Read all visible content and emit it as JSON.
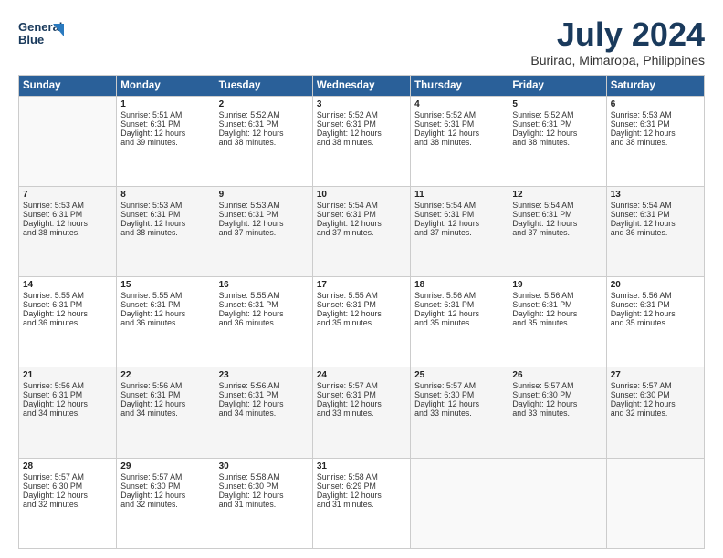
{
  "header": {
    "logo_line1": "General",
    "logo_line2": "Blue",
    "month": "July 2024",
    "location": "Burirao, Mimaropa, Philippines"
  },
  "weekdays": [
    "Sunday",
    "Monday",
    "Tuesday",
    "Wednesday",
    "Thursday",
    "Friday",
    "Saturday"
  ],
  "weeks": [
    [
      {
        "day": "",
        "info": ""
      },
      {
        "day": "1",
        "info": "Sunrise: 5:51 AM\nSunset: 6:31 PM\nDaylight: 12 hours\nand 39 minutes."
      },
      {
        "day": "2",
        "info": "Sunrise: 5:52 AM\nSunset: 6:31 PM\nDaylight: 12 hours\nand 38 minutes."
      },
      {
        "day": "3",
        "info": "Sunrise: 5:52 AM\nSunset: 6:31 PM\nDaylight: 12 hours\nand 38 minutes."
      },
      {
        "day": "4",
        "info": "Sunrise: 5:52 AM\nSunset: 6:31 PM\nDaylight: 12 hours\nand 38 minutes."
      },
      {
        "day": "5",
        "info": "Sunrise: 5:52 AM\nSunset: 6:31 PM\nDaylight: 12 hours\nand 38 minutes."
      },
      {
        "day": "6",
        "info": "Sunrise: 5:53 AM\nSunset: 6:31 PM\nDaylight: 12 hours\nand 38 minutes."
      }
    ],
    [
      {
        "day": "7",
        "info": "Sunrise: 5:53 AM\nSunset: 6:31 PM\nDaylight: 12 hours\nand 38 minutes."
      },
      {
        "day": "8",
        "info": "Sunrise: 5:53 AM\nSunset: 6:31 PM\nDaylight: 12 hours\nand 38 minutes."
      },
      {
        "day": "9",
        "info": "Sunrise: 5:53 AM\nSunset: 6:31 PM\nDaylight: 12 hours\nand 37 minutes."
      },
      {
        "day": "10",
        "info": "Sunrise: 5:54 AM\nSunset: 6:31 PM\nDaylight: 12 hours\nand 37 minutes."
      },
      {
        "day": "11",
        "info": "Sunrise: 5:54 AM\nSunset: 6:31 PM\nDaylight: 12 hours\nand 37 minutes."
      },
      {
        "day": "12",
        "info": "Sunrise: 5:54 AM\nSunset: 6:31 PM\nDaylight: 12 hours\nand 37 minutes."
      },
      {
        "day": "13",
        "info": "Sunrise: 5:54 AM\nSunset: 6:31 PM\nDaylight: 12 hours\nand 36 minutes."
      }
    ],
    [
      {
        "day": "14",
        "info": "Sunrise: 5:55 AM\nSunset: 6:31 PM\nDaylight: 12 hours\nand 36 minutes."
      },
      {
        "day": "15",
        "info": "Sunrise: 5:55 AM\nSunset: 6:31 PM\nDaylight: 12 hours\nand 36 minutes."
      },
      {
        "day": "16",
        "info": "Sunrise: 5:55 AM\nSunset: 6:31 PM\nDaylight: 12 hours\nand 36 minutes."
      },
      {
        "day": "17",
        "info": "Sunrise: 5:55 AM\nSunset: 6:31 PM\nDaylight: 12 hours\nand 35 minutes."
      },
      {
        "day": "18",
        "info": "Sunrise: 5:56 AM\nSunset: 6:31 PM\nDaylight: 12 hours\nand 35 minutes."
      },
      {
        "day": "19",
        "info": "Sunrise: 5:56 AM\nSunset: 6:31 PM\nDaylight: 12 hours\nand 35 minutes."
      },
      {
        "day": "20",
        "info": "Sunrise: 5:56 AM\nSunset: 6:31 PM\nDaylight: 12 hours\nand 35 minutes."
      }
    ],
    [
      {
        "day": "21",
        "info": "Sunrise: 5:56 AM\nSunset: 6:31 PM\nDaylight: 12 hours\nand 34 minutes."
      },
      {
        "day": "22",
        "info": "Sunrise: 5:56 AM\nSunset: 6:31 PM\nDaylight: 12 hours\nand 34 minutes."
      },
      {
        "day": "23",
        "info": "Sunrise: 5:56 AM\nSunset: 6:31 PM\nDaylight: 12 hours\nand 34 minutes."
      },
      {
        "day": "24",
        "info": "Sunrise: 5:57 AM\nSunset: 6:31 PM\nDaylight: 12 hours\nand 33 minutes."
      },
      {
        "day": "25",
        "info": "Sunrise: 5:57 AM\nSunset: 6:30 PM\nDaylight: 12 hours\nand 33 minutes."
      },
      {
        "day": "26",
        "info": "Sunrise: 5:57 AM\nSunset: 6:30 PM\nDaylight: 12 hours\nand 33 minutes."
      },
      {
        "day": "27",
        "info": "Sunrise: 5:57 AM\nSunset: 6:30 PM\nDaylight: 12 hours\nand 32 minutes."
      }
    ],
    [
      {
        "day": "28",
        "info": "Sunrise: 5:57 AM\nSunset: 6:30 PM\nDaylight: 12 hours\nand 32 minutes."
      },
      {
        "day": "29",
        "info": "Sunrise: 5:57 AM\nSunset: 6:30 PM\nDaylight: 12 hours\nand 32 minutes."
      },
      {
        "day": "30",
        "info": "Sunrise: 5:58 AM\nSunset: 6:30 PM\nDaylight: 12 hours\nand 31 minutes."
      },
      {
        "day": "31",
        "info": "Sunrise: 5:58 AM\nSunset: 6:29 PM\nDaylight: 12 hours\nand 31 minutes."
      },
      {
        "day": "",
        "info": ""
      },
      {
        "day": "",
        "info": ""
      },
      {
        "day": "",
        "info": ""
      }
    ]
  ]
}
